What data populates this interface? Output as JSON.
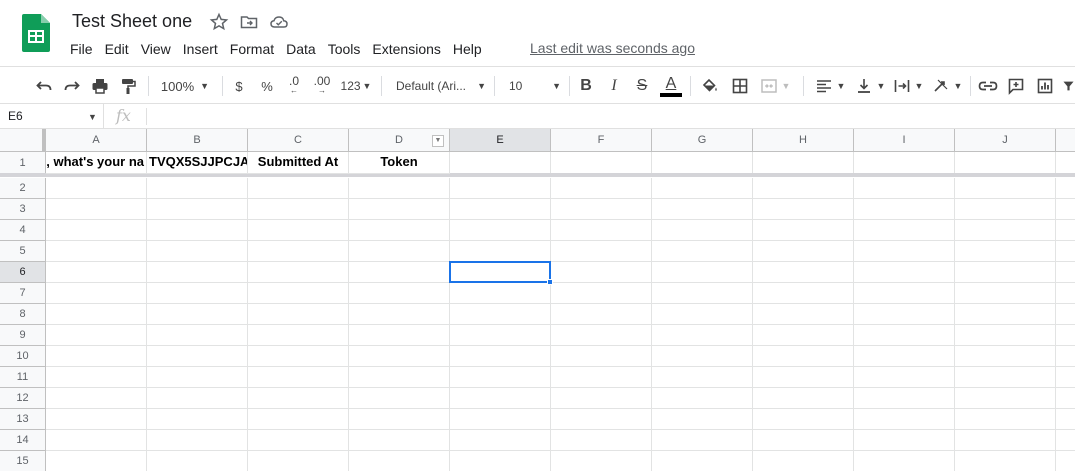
{
  "doc": {
    "title": "Test Sheet one",
    "last_edit": "Last edit was seconds ago"
  },
  "icons": {
    "logo": "google-sheets-logo",
    "star": "star-icon",
    "move": "move-to-folder-icon",
    "cloud": "cloud-status-icon"
  },
  "colors": {
    "sheets_green": "#0f9d58",
    "selection_blue": "#1a73e8",
    "text_color_bar": "#000000"
  },
  "menu": [
    "File",
    "Edit",
    "View",
    "Insert",
    "Format",
    "Data",
    "Tools",
    "Extensions",
    "Help"
  ],
  "toolbar": {
    "zoom": "100%",
    "currency": "$",
    "percent": "%",
    "decrease_decimal": ".0",
    "increase_decimal": ".00",
    "more_formats": "123",
    "font": "Default (Ari...",
    "font_size": "10",
    "bold": "B",
    "italic": "I",
    "strikethrough": "S",
    "text_color": "A"
  },
  "formula_bar": {
    "name_box": "E6",
    "fx": "fx",
    "content": ""
  },
  "grid": {
    "columns": [
      "A",
      "B",
      "C",
      "D",
      "E",
      "F",
      "G",
      "H",
      "I",
      "J"
    ],
    "rows": [
      "1",
      "2",
      "3",
      "4",
      "5",
      "6",
      "7",
      "8",
      "9",
      "10",
      "11",
      "12",
      "13",
      "14",
      "15"
    ],
    "selected_cell": "E6",
    "header_row": {
      "A": "o, what's your na",
      "B": "TVQX5SJJPCJA",
      "C": "Submitted At",
      "D": "Token"
    }
  }
}
